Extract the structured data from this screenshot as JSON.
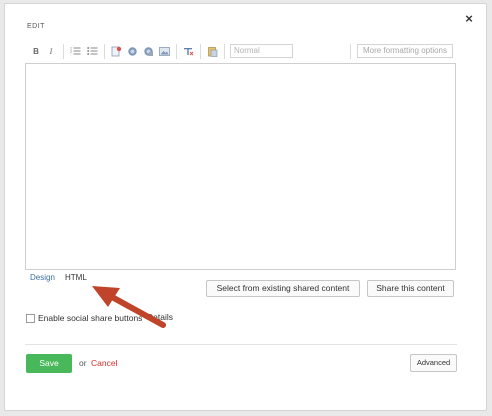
{
  "dialog": {
    "title": "EDIT",
    "close_label": "×"
  },
  "toolbar": {
    "bold_label": "B",
    "italic_label": "I",
    "style_placeholder": "Normal",
    "more_options_label": "More formatting options"
  },
  "editor": {
    "content": ""
  },
  "mode_tabs": {
    "design": "Design",
    "html": "HTML"
  },
  "buttons": {
    "select_existing": "Select from existing shared content",
    "share_content": "Share this content",
    "save": "Save",
    "or_text": "or",
    "cancel": "Cancel",
    "advanced": "Advanced"
  },
  "social": {
    "checkbox_label": "Enable social share buttons",
    "details_link": "Details",
    "checked": false
  },
  "colors": {
    "save_green": "#48b85b",
    "cancel_red": "#d0312d",
    "annotation_arrow": "#c0442a",
    "design_link": "#3a6ea5"
  }
}
